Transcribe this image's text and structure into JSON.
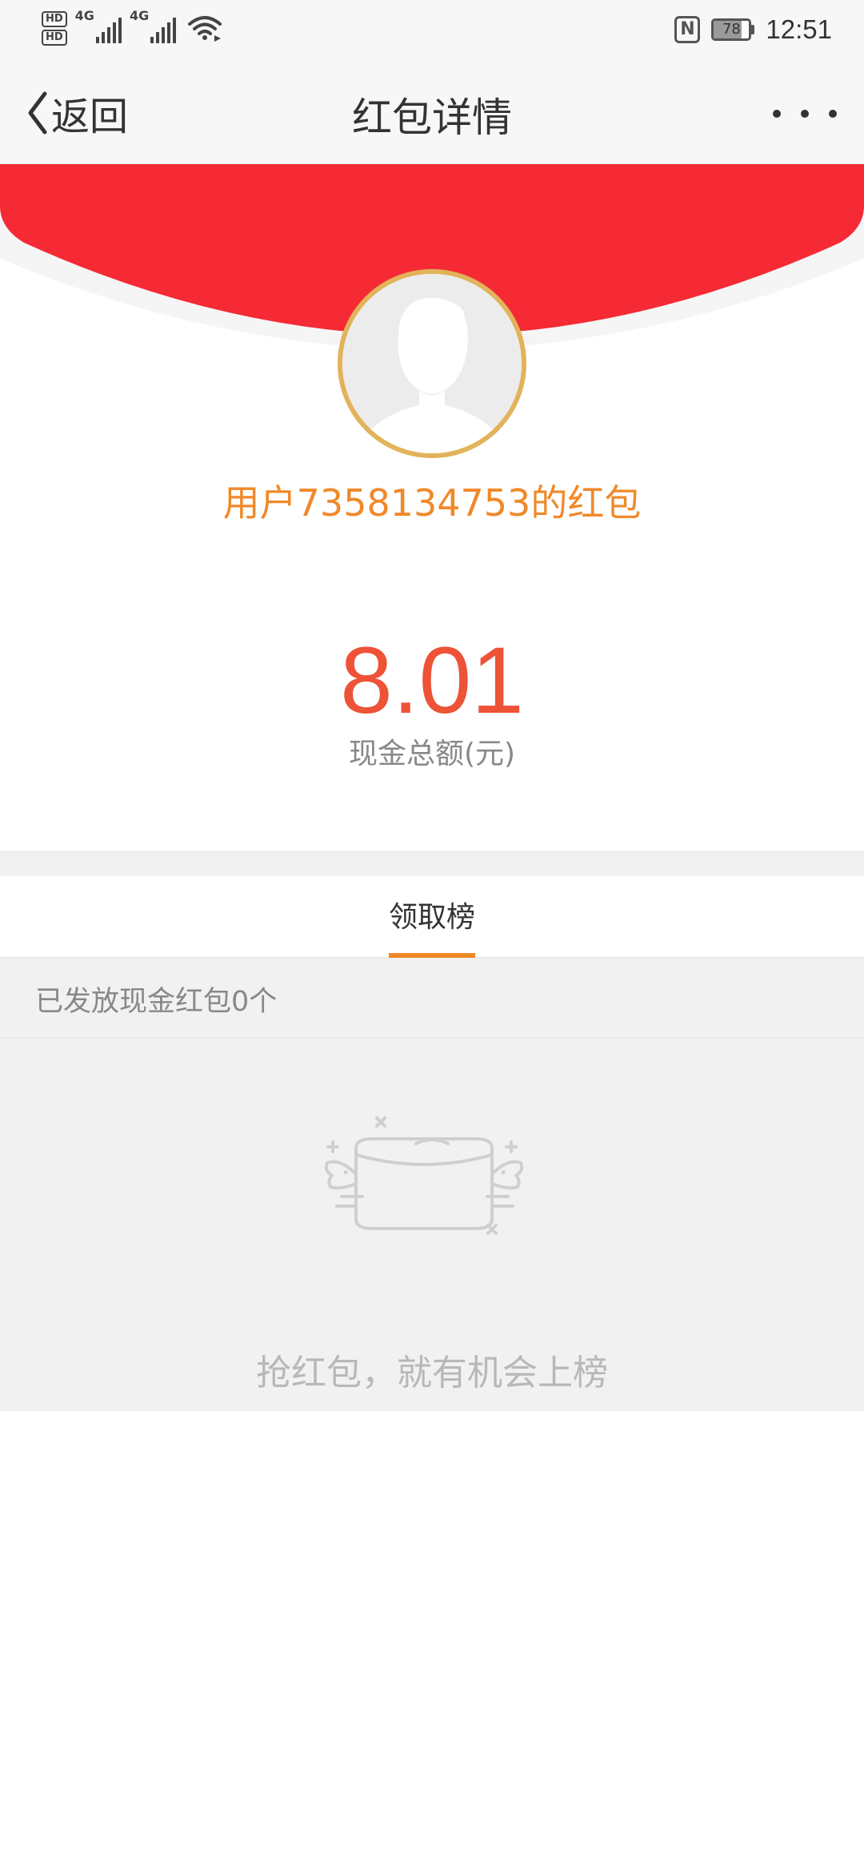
{
  "status_bar": {
    "hd1": "HD",
    "hd2": "HD",
    "network1": "4G",
    "network2": "4G",
    "nfc_label": "N",
    "battery_level": 78,
    "battery_text": "78",
    "time": "12:51"
  },
  "header": {
    "back_label": "返回",
    "title": "红包详情"
  },
  "envelope": {
    "sender": "用户7358134753的红包",
    "amount": "8.01",
    "amount_caption": "现金总额(元)"
  },
  "tabs": [
    {
      "label": "领取榜",
      "active": true
    }
  ],
  "summary": {
    "count_text": "已发放现金红包0个"
  },
  "empty_state": {
    "message": "抢红包，就有机会上榜"
  },
  "colors": {
    "envelope_red": "#f52a35",
    "accent_orange": "#f0892a",
    "amount_red": "#ee5237",
    "avatar_border": "#e2b35a"
  }
}
